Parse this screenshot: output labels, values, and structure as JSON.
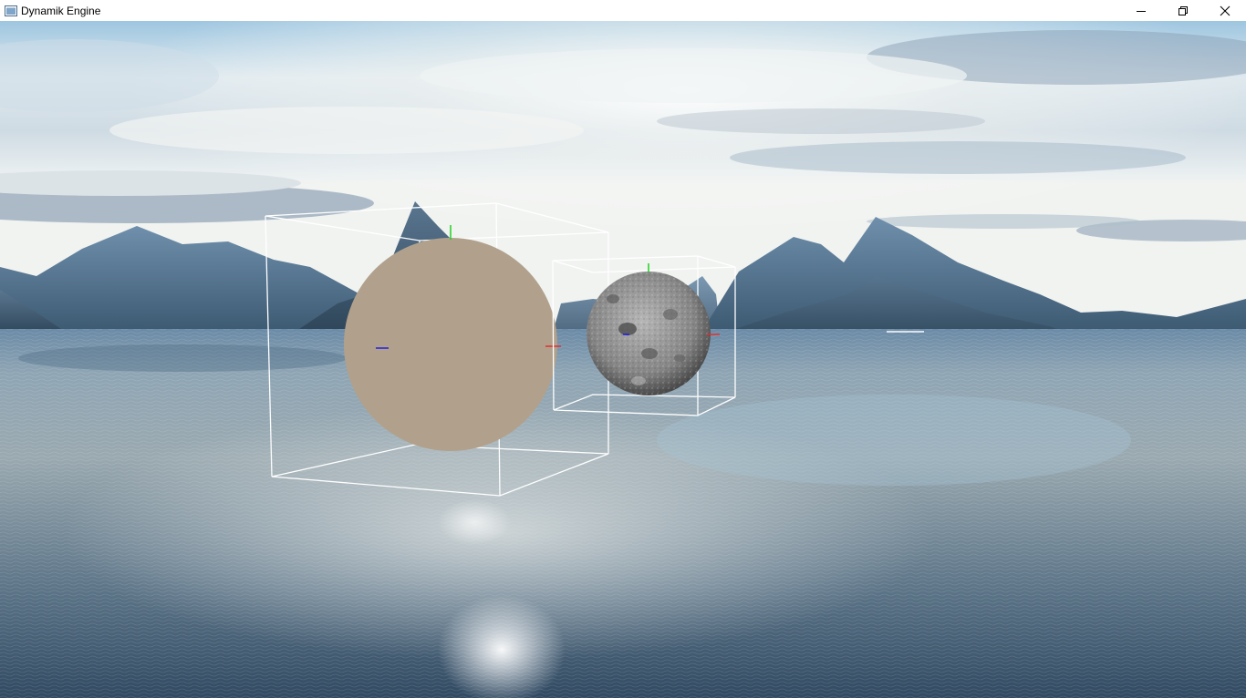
{
  "window": {
    "title": "Dynamik Engine",
    "app_icon": "app-window-icon",
    "controls": [
      "minimize-icon",
      "restore-icon",
      "close-icon"
    ]
  },
  "viewport": {
    "background": "skybox-ocean-mountains",
    "objects": [
      {
        "name": "plain-sphere",
        "color": "#B1A18C",
        "has_bounding_box": true,
        "has_axis_gizmo": true
      },
      {
        "name": "moon-textured-sphere",
        "color": "#8A8A8A",
        "has_bounding_box": true,
        "has_axis_gizmo": true
      }
    ],
    "gizmo_colors": {
      "x": "#E03030",
      "y": "#20D020",
      "z": "#2020E0"
    }
  }
}
